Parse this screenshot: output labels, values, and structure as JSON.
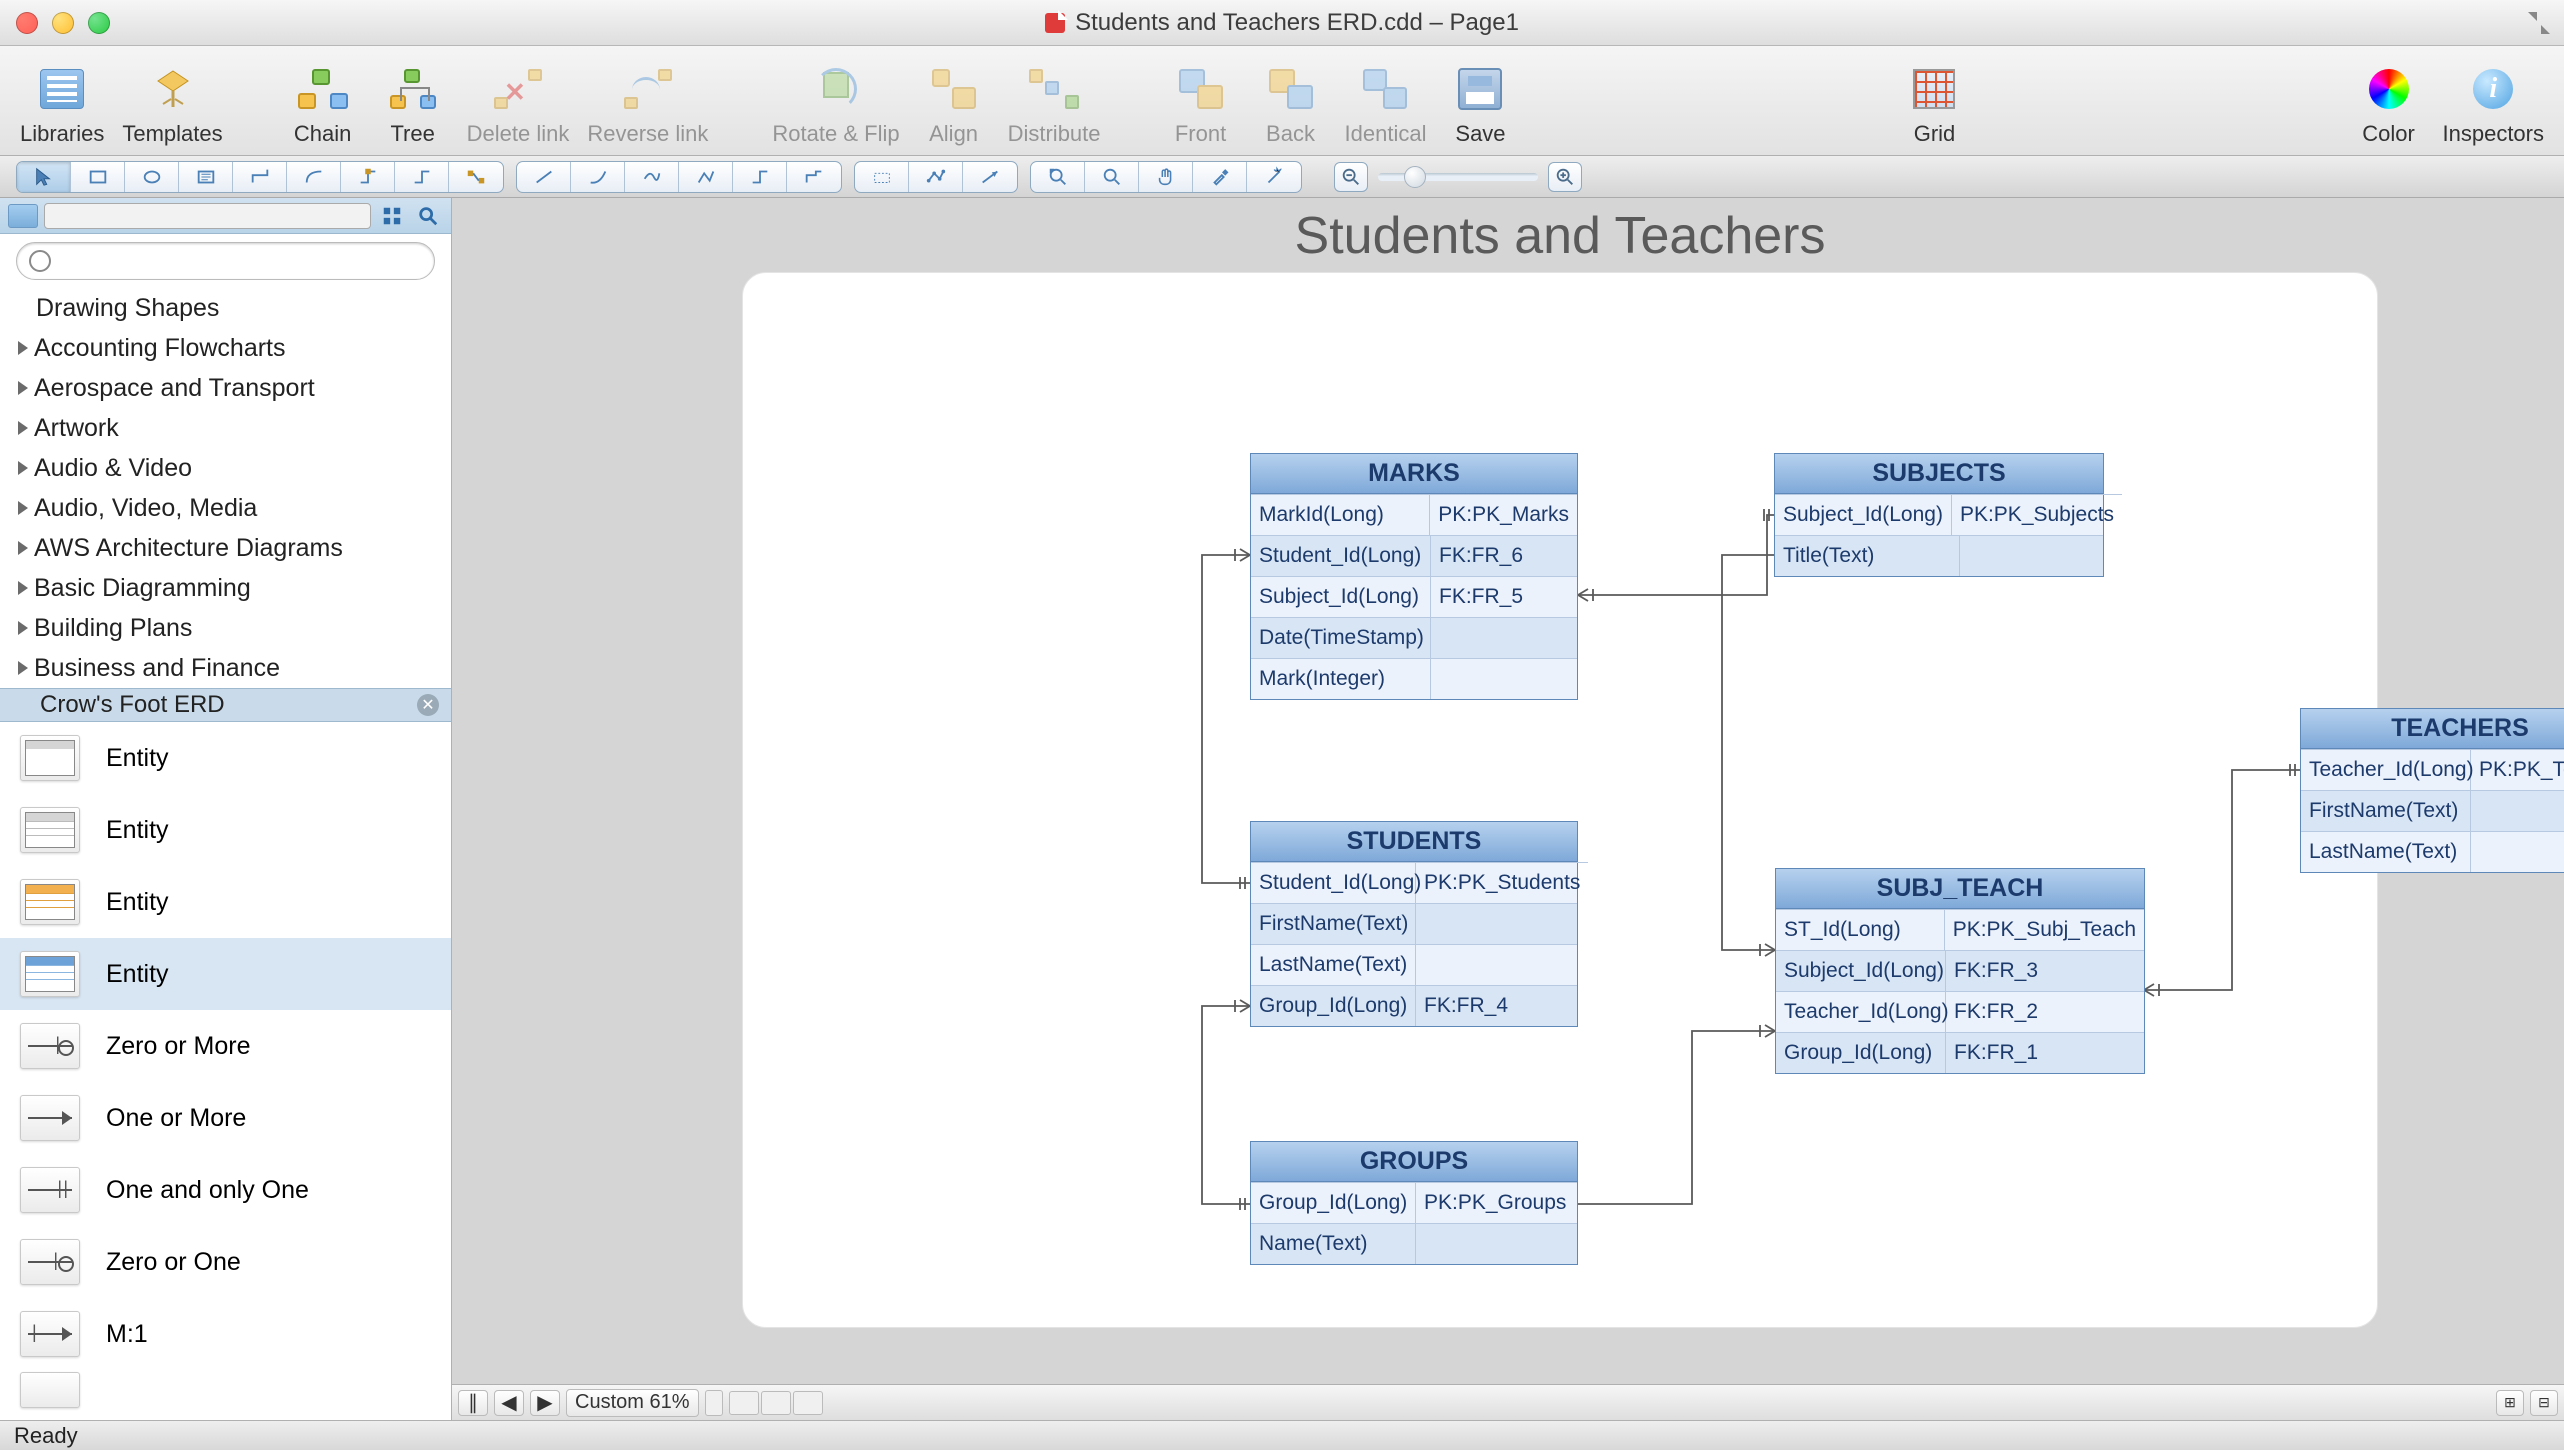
{
  "window": {
    "title": "Students and Teachers ERD.cdd – Page1"
  },
  "toolbar": {
    "libraries": "Libraries",
    "templates": "Templates",
    "chain": "Chain",
    "tree": "Tree",
    "delete_link": "Delete link",
    "reverse_link": "Reverse link",
    "rotate_flip": "Rotate & Flip",
    "align": "Align",
    "distribute": "Distribute",
    "front": "Front",
    "back": "Back",
    "identical": "Identical",
    "save": "Save",
    "grid": "Grid",
    "color": "Color",
    "inspectors": "Inspectors"
  },
  "sidebar": {
    "search_placeholder": "",
    "main_search_placeholder": "",
    "categories": [
      "Drawing Shapes",
      "Accounting Flowcharts",
      "Aerospace and Transport",
      "Artwork",
      "Audio & Video",
      "Audio, Video, Media",
      "AWS Architecture Diagrams",
      "Basic Diagramming",
      "Building Plans",
      "Business and Finance"
    ],
    "active_category": "Crow's Foot ERD",
    "shapes": [
      {
        "label": "Entity"
      },
      {
        "label": "Entity"
      },
      {
        "label": "Entity"
      },
      {
        "label": "Entity"
      },
      {
        "label": "Zero or More"
      },
      {
        "label": "One or More"
      },
      {
        "label": "One and only One"
      },
      {
        "label": "Zero or One"
      },
      {
        "label": "M:1"
      }
    ]
  },
  "canvas": {
    "title": "Students and Teachers",
    "zoom_label": "Custom 61%",
    "entities": {
      "marks": {
        "title": "MARKS",
        "rows": [
          {
            "c1": "MarkId(Long)",
            "c2": "PK:PK_Marks"
          },
          {
            "c1": "Student_Id(Long)",
            "c2": "FK:FR_6"
          },
          {
            "c1": "Subject_Id(Long)",
            "c2": "FK:FR_5"
          },
          {
            "c1": "Date(TimeStamp)",
            "c2": ""
          },
          {
            "c1": "Mark(Integer)",
            "c2": ""
          }
        ]
      },
      "subjects": {
        "title": "SUBJECTS",
        "rows": [
          {
            "c1": "Subject_Id(Long)",
            "c2": "PK:PK_Subjects"
          },
          {
            "c1": "Title(Text)",
            "c2": ""
          }
        ]
      },
      "students": {
        "title": "STUDENTS",
        "rows": [
          {
            "c1": "Student_Id(Long)",
            "c2": "PK:PK_Students"
          },
          {
            "c1": "FirstName(Text)",
            "c2": ""
          },
          {
            "c1": "LastName(Text)",
            "c2": ""
          },
          {
            "c1": "Group_Id(Long)",
            "c2": "FK:FR_4"
          }
        ]
      },
      "subj_teach": {
        "title": "SUBJ_TEACH",
        "rows": [
          {
            "c1": "ST_Id(Long)",
            "c2": "PK:PK_Subj_Teach"
          },
          {
            "c1": "Subject_Id(Long)",
            "c2": "FK:FR_3"
          },
          {
            "c1": "Teacher_Id(Long)",
            "c2": "FK:FR_2"
          },
          {
            "c1": "Group_Id(Long)",
            "c2": "FK:FR_1"
          }
        ]
      },
      "teachers": {
        "title": "TEACHERS",
        "rows": [
          {
            "c1": "Teacher_Id(Long)",
            "c2": "PK:PK_Teachers"
          },
          {
            "c1": "FirstName(Text)",
            "c2": ""
          },
          {
            "c1": "LastName(Text)",
            "c2": ""
          }
        ]
      },
      "groups": {
        "title": "GROUPS",
        "rows": [
          {
            "c1": "Group_Id(Long)",
            "c2": "PK:PK_Groups"
          },
          {
            "c1": "Name(Text)",
            "c2": ""
          }
        ]
      }
    }
  },
  "status": {
    "text": "Ready"
  }
}
